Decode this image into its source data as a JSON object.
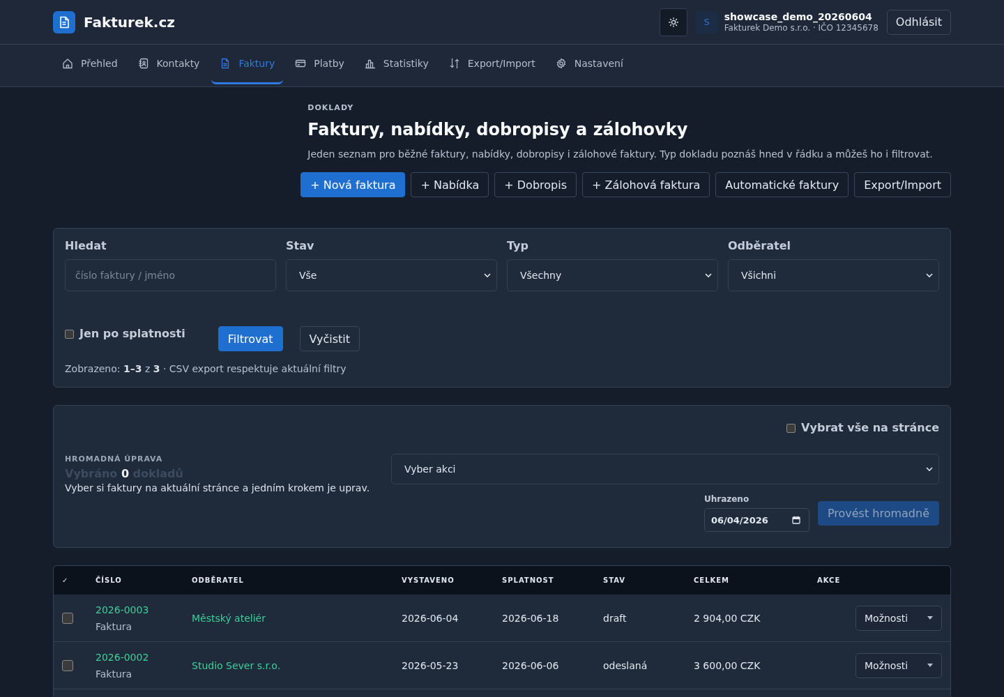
{
  "header": {
    "logo_text": "Fakturek.cz",
    "user": {
      "avatar_initial": "S",
      "name": "showcase_demo_20260604",
      "company": "Fakturek Demo s.r.o. · IČO 12345678"
    },
    "logout_button": "Odhlásit"
  },
  "nav": [
    {
      "label": "Přehled",
      "selected": false
    },
    {
      "label": "Kontakty",
      "selected": false
    },
    {
      "label": "Faktury",
      "selected": true
    },
    {
      "label": "Platby",
      "selected": false
    },
    {
      "label": "Statistiky",
      "selected": false
    },
    {
      "label": "Export/Import",
      "selected": false
    },
    {
      "label": "Nastavení",
      "selected": false
    }
  ],
  "page_header": {
    "eyebrow": "DOKLADY",
    "title": "Faktury, nabídky, dobropisy a zálohovky",
    "description": "Jeden seznam pro běžné faktury, nabídky, dobropisy i zálohové faktury. Typ dokladu poznáš hned v řádku a můžeš ho i filtrovat.",
    "buttons": [
      {
        "label": "+ Nová faktura",
        "kind": "primary"
      },
      {
        "label": "+ Nabídka",
        "kind": "outline"
      },
      {
        "label": "+ Dobropis",
        "kind": "outline"
      },
      {
        "label": "+ Zálohová faktura",
        "kind": "outline"
      },
      {
        "label": "Automatické faktury",
        "kind": "outline"
      },
      {
        "label": "Export/Import",
        "kind": "outline"
      }
    ]
  },
  "filters": {
    "fields": [
      {
        "kind": "search",
        "label": "Hledat",
        "placeholder": "číslo faktury / jméno"
      },
      {
        "kind": "select",
        "label": "Stav",
        "value": "Vše"
      },
      {
        "kind": "select",
        "label": "Typ",
        "value": "Všechny"
      },
      {
        "kind": "select",
        "label": "Odběratel",
        "value": "Všichni"
      }
    ],
    "overdue_only": {
      "label": "Jen po splatnosti",
      "checked": false
    },
    "buttons": [
      {
        "label": "Filtrovat",
        "kind": "primary"
      },
      {
        "label": "Vyčistit",
        "kind": "outline"
      }
    ],
    "summary": "Zobrazeno: **1–3** z **3** · CSV export respektuje aktuální filtry"
  },
  "bulk_edit": {
    "select_all": {
      "label": "Vybrat vše na stránce",
      "checked": false
    },
    "eyebrow": "HROMADNÁ ÚPRAVA",
    "selection": "Vybráno **0** dokladů",
    "description": "Vyber si faktury na aktuální stránce a jedním krokem je uprav.",
    "action_select": {
      "value": "Vyber akci"
    },
    "date_field": {
      "label": "Uhrazeno",
      "value": "06/04/2026"
    },
    "apply_button": {
      "label": "Provést hromadně",
      "disabled": true
    }
  },
  "table": {
    "columns": [
      "✓",
      "ČÍSLO",
      "ODBĚRATEL",
      "VYSTAVENO",
      "SPLATNOST",
      "STAV",
      "CELKEM",
      "AKCE"
    ],
    "rows": [
      {
        "checked": false,
        "number": "2026-0003",
        "type": "Faktura",
        "customer": "Městský ateliér",
        "issued": "2026-06-04",
        "due": "2026-06-18",
        "status": "draft",
        "total": "2 904,00 CZK",
        "action": "Možnosti"
      },
      {
        "checked": false,
        "number": "2026-0002",
        "type": "Faktura",
        "customer": "Studio Sever s.r.o.",
        "issued": "2026-05-23",
        "due": "2026-06-06",
        "status": "odeslaná",
        "total": "3 600,00 CZK",
        "action": "Možnosti"
      }
    ]
  }
}
